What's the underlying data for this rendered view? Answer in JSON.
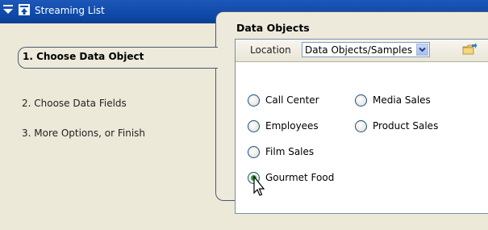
{
  "window": {
    "title": "Streaming List"
  },
  "steps": [
    {
      "label": "1. Choose Data Object",
      "active": true
    },
    {
      "label": "2. Choose Data Fields",
      "active": false
    },
    {
      "label": "3. More Options, or Finish",
      "active": false
    }
  ],
  "panel": {
    "heading": "Data Objects",
    "location": {
      "label": "Location",
      "value": "Data Objects/Samples"
    },
    "options": [
      {
        "label": "Call Center",
        "checked": false
      },
      {
        "label": "Media Sales",
        "checked": false
      },
      {
        "label": "Employees",
        "checked": false
      },
      {
        "label": "Product Sales",
        "checked": false
      },
      {
        "label": "Film Sales",
        "checked": false
      },
      {
        "label": "Gourmet Food",
        "checked": true
      }
    ]
  },
  "icons": [
    "menu-collapse-icon",
    "app-icon",
    "dropdown-arrow-icon",
    "folder-browse-icon",
    "mouse-cursor-icon"
  ],
  "colors": {
    "titlebar": "#0f4aa9",
    "panel_border": "#4a5a75",
    "background": "#ece9d8",
    "radio_checked": "#2b9a2b"
  }
}
